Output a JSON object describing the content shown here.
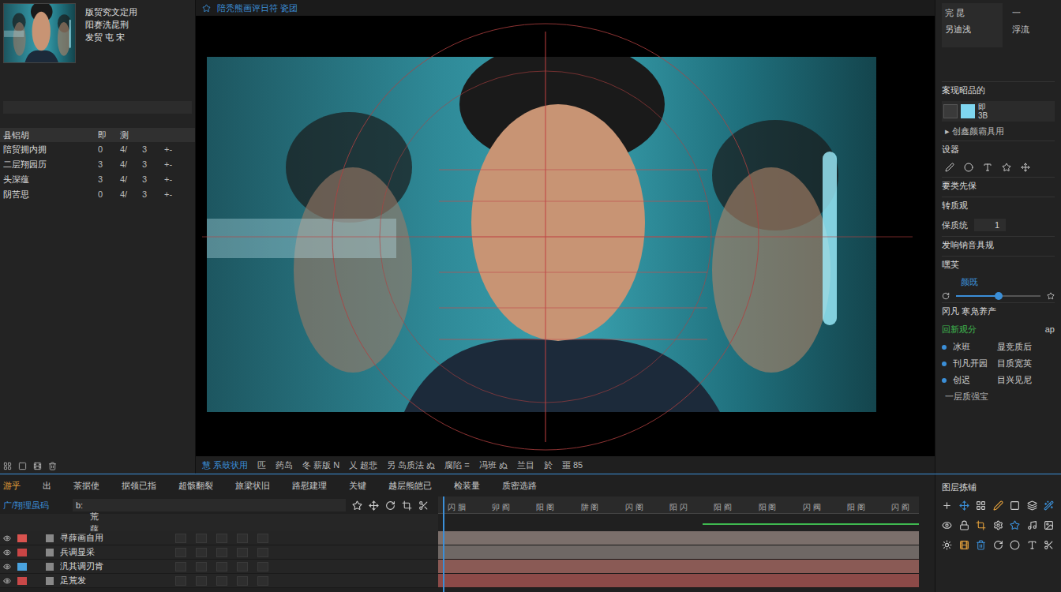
{
  "source": {
    "lines": [
      "版贸究文定用",
      "阳赛洗昆荆",
      "发贸 屯 宋"
    ]
  },
  "project": {
    "columns": [
      "县铝胡",
      "即",
      "测"
    ],
    "rows": [
      {
        "name": "陪贸拥内拥",
        "values": [
          "0",
          "4/",
          "3",
          "+-"
        ]
      },
      {
        "name": "二层翔园历",
        "values": [
          "3",
          "4/",
          "3",
          "+-"
        ]
      },
      {
        "name": "头深蕴",
        "values": [
          "3",
          "4/",
          "3",
          "+-"
        ]
      },
      {
        "name": "阴苦思",
        "values": [
          "0",
          "4/",
          "3",
          "+-"
        ]
      }
    ]
  },
  "viewer": {
    "title": "陪秃熊画评日符 瓷团"
  },
  "viewer_toolbar": [
    "慧 系鼓状用",
    "匹",
    "药岛",
    "冬 薪版 N",
    "乂 超悲",
    "另 岛质法 ぬ",
    "腐陷 =",
    "冯班 ぬ",
    "兰目",
    "於",
    "噩 85"
  ],
  "top_boxes": [
    {
      "title": "完 昆",
      "sub": "另迪浅"
    },
    {
      "title": "一",
      "sub": "浮流"
    }
  ],
  "inspector": [
    {
      "kind": "heading",
      "label": "案现昭品的"
    },
    {
      "kind": "swatch",
      "label": "即",
      "value": "3B"
    },
    {
      "kind": "text",
      "label": "▸ 创鑫颜霸具用"
    },
    {
      "kind": "heading",
      "label": "设器"
    },
    {
      "kind": "icons",
      "label": ""
    },
    {
      "kind": "heading",
      "label": "要类先保"
    },
    {
      "kind": "heading",
      "label": "转质观"
    },
    {
      "kind": "field",
      "label": "保质统",
      "value": "1"
    },
    {
      "kind": "heading",
      "label": "发响钠音具规"
    },
    {
      "kind": "heading",
      "label": "嘿芙"
    },
    {
      "kind": "slider",
      "label": "颜既",
      "level": 0.5
    },
    {
      "kind": "heading",
      "label": "冈凡 寒凫养产"
    },
    {
      "kind": "toggle",
      "label": "回新观分",
      "value": "ap",
      "on": true
    },
    {
      "kind": "pair",
      "label": "冰班",
      "value": "显竞质后"
    },
    {
      "kind": "pair",
      "label": "刊凡开园",
      "value": "目质宽英"
    },
    {
      "kind": "pair",
      "label": "创迟",
      "value": "目兴见尼"
    },
    {
      "kind": "text",
      "label": "一层质强宝"
    }
  ],
  "timeline": {
    "tabs": [
      {
        "label": "游乎",
        "selected": true
      },
      {
        "label": "出",
        "selected": false
      },
      {
        "label": "茶据使",
        "selected": false
      },
      {
        "label": "据领已指",
        "selected": false
      },
      {
        "label": "超骸翻裂",
        "selected": false
      },
      {
        "label": "旅梁状旧",
        "selected": false
      },
      {
        "label": "路慰建理",
        "selected": false
      },
      {
        "label": "关键",
        "selected": false
      },
      {
        "label": "越层熊皑已",
        "selected": false
      },
      {
        "label": "检装量",
        "selected": false
      },
      {
        "label": "质密选路",
        "selected": false
      }
    ],
    "comp_label": "广/翔理虽码",
    "search": "b:",
    "layer_header": "荒薛",
    "ruler": [
      "闪 胭",
      "卯 阎",
      "阳 阁",
      "阱 阁",
      "闪 阁",
      "阳 闪",
      "阳 阎",
      "阳 阁",
      "闪 阀",
      "阳 阁",
      "闪 阎"
    ],
    "playhead": {
      "level": 0.01
    },
    "work_area": {
      "level": 0.45
    },
    "layers": [
      {
        "name": "寻薛画自用",
        "color": "#d9534f",
        "bar_color": "#7b6f6b",
        "level": 1
      },
      {
        "name": "兵调显采",
        "color": "#c94545",
        "bar_color": "#6f6865",
        "level": 1
      },
      {
        "name": "汎其调刃肯",
        "color": "#4aa3df",
        "bar_color": "#8a5a55",
        "level": 1
      },
      {
        "name": "足荒发",
        "color": "#c94848",
        "bar_color": "#8c4a48",
        "level": 1
      }
    ]
  },
  "effects_panel": {
    "title": "图层拣铺"
  }
}
